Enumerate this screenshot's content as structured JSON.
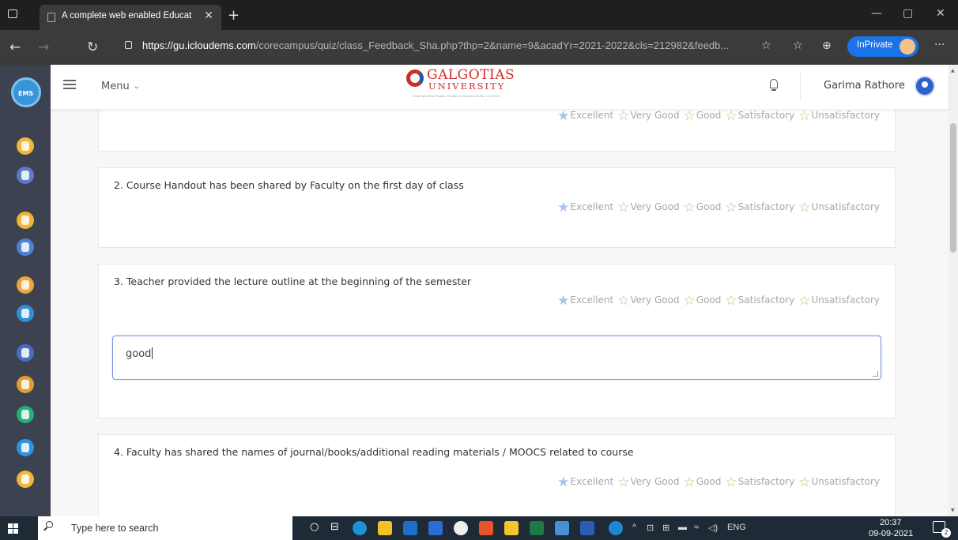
{
  "browser": {
    "tab_title": "A complete web enabled Educat",
    "tab_close": "✕",
    "url_host": "https://gu.icloudems.com",
    "url_path": "/corecampus/quiz/class_Feedback_Sha.php?thp=2&name=9&acadYr=2021-2022&cls=212982&feedb...",
    "inprivate_label": "InPrivate"
  },
  "header": {
    "menu_label": "Menu",
    "logo_line1": "GALGOTIAS",
    "logo_line2": "UNIVERSITY",
    "logo_tagline": "Under the Uttar Pradesh Private Universities Act No. 14 of 2011",
    "user_name": "Garima Rathore"
  },
  "sidebar": {
    "logo_text": "EMS",
    "icons": [
      {
        "name": "sidebar-icon-1",
        "color": "#f0b73a"
      },
      {
        "name": "sidebar-icon-2",
        "color": "#5b7bc7"
      },
      {
        "name": "sidebar-icon-3",
        "color": "#f2b533"
      },
      {
        "name": "sidebar-icon-4",
        "color": "#4a82d6"
      },
      {
        "name": "sidebar-icon-5",
        "color": "#f0a43a"
      },
      {
        "name": "sidebar-icon-6",
        "color": "#2f8fd8"
      },
      {
        "name": "sidebar-icon-7",
        "color": "#4470c4"
      },
      {
        "name": "sidebar-icon-8",
        "color": "#e0a030"
      },
      {
        "name": "sidebar-icon-9",
        "color": "#23b07a"
      },
      {
        "name": "sidebar-icon-10",
        "color": "#2f95e0"
      },
      {
        "name": "sidebar-icon-11",
        "color": "#f0b73a"
      }
    ]
  },
  "rating_options": [
    "Excellent",
    "Very Good",
    "Good",
    "Satisfactory",
    "Unsatisfactory"
  ],
  "questions": [
    {
      "text": "",
      "selected": "Excellent"
    },
    {
      "text": "2. Course Handout has been shared by Faculty on the first day of class",
      "selected": "Excellent"
    },
    {
      "text": "3. Teacher provided the lecture outline at the beginning of the semester",
      "selected": "Excellent",
      "answer": "good"
    },
    {
      "text": "4. Faculty has shared the names of journal/books/additional reading materials / MOOCS related to course",
      "selected": "Excellent"
    }
  ],
  "taskbar": {
    "search_placeholder": "Type here to search",
    "lang": "ENG",
    "time": "20:37",
    "date": "09-09-2021",
    "notification_count": "2"
  }
}
